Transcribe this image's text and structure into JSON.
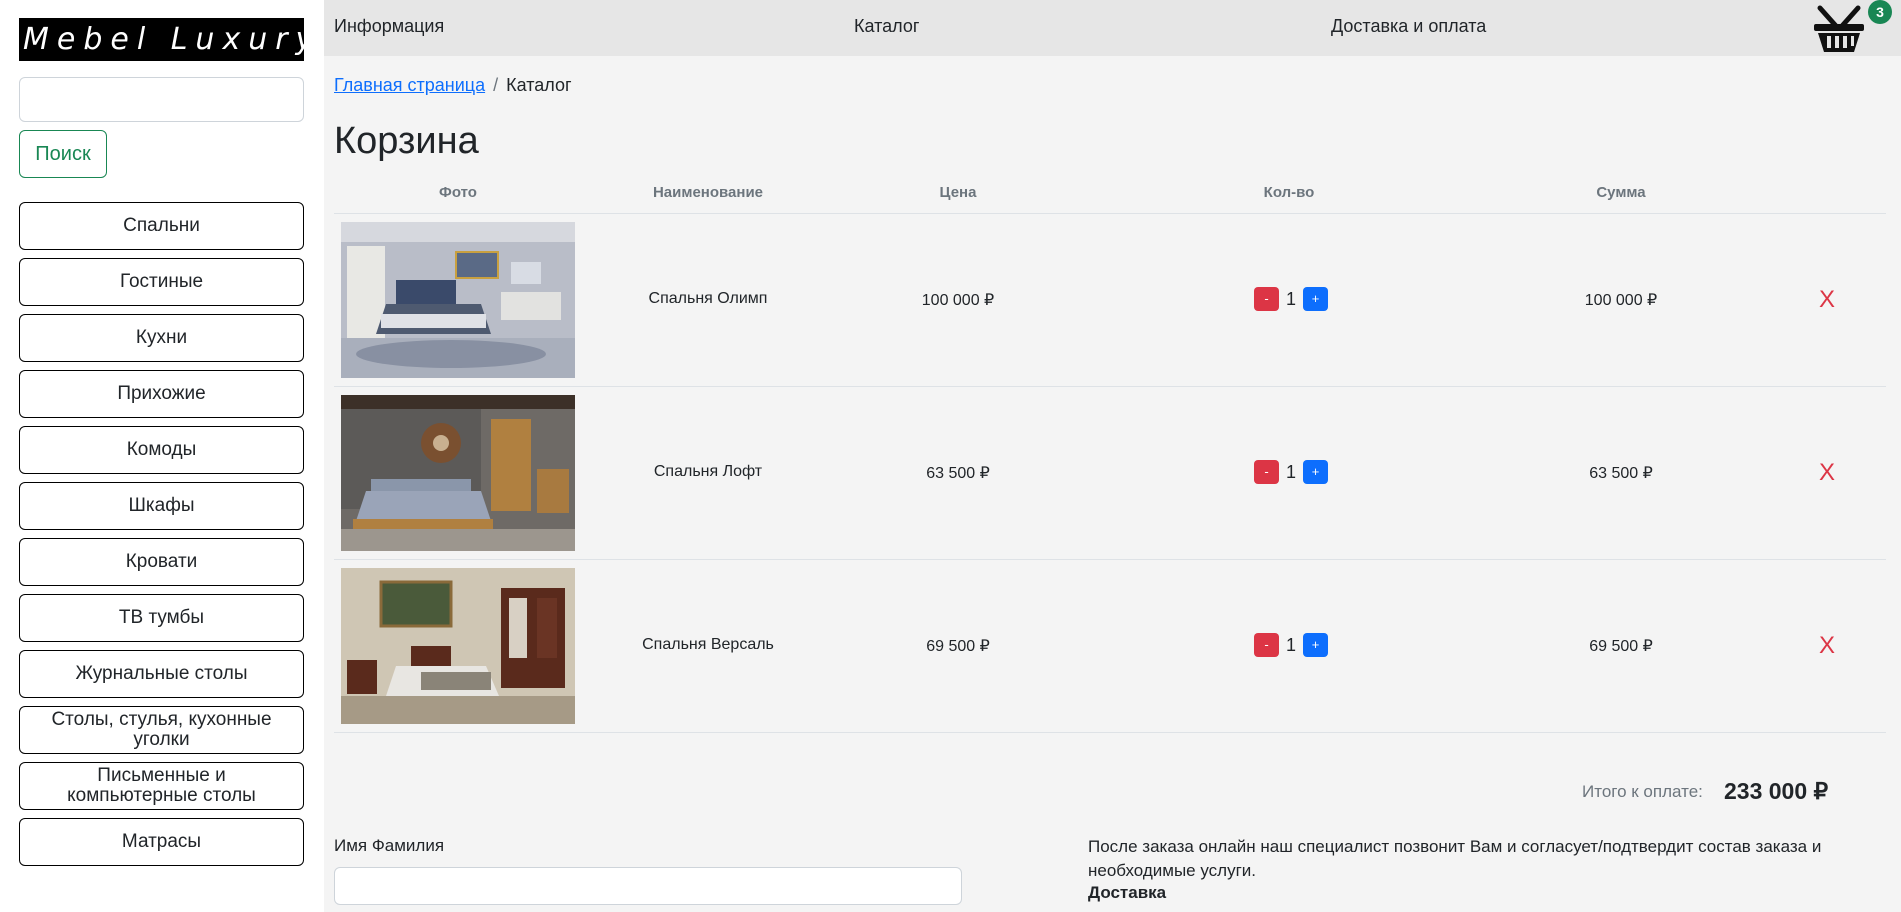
{
  "brand": {
    "logo_text": "Mebel Luxury"
  },
  "search": {
    "button_label": "Поиск",
    "placeholder": ""
  },
  "categories": [
    "Спальни",
    "Гостиные",
    "Кухни",
    "Прихожие",
    "Комоды",
    "Шкафы",
    "Кровати",
    "ТВ тумбы",
    "Журнальные столы",
    "Столы, стулья, кухонные уголки",
    "Письменные и компьютерные столы",
    "Матрасы"
  ],
  "nav": {
    "info": "Информация",
    "catalog": "Каталог",
    "delivery": "Доставка и оплата",
    "cart_count": "3"
  },
  "breadcrumb": {
    "home": "Главная страница",
    "separator": "/",
    "current": "Каталог"
  },
  "page_title": "Корзина",
  "table": {
    "headers": {
      "photo": "Фото",
      "name": "Наименование",
      "price": "Цена",
      "qty": "Кол-во",
      "sum": "Сумма"
    },
    "rows": [
      {
        "name": "Спальня Олимп",
        "price": "100 000 ₽",
        "qty": "1",
        "sum": "100 000 ₽",
        "minus": "-",
        "plus": "+",
        "delete": "X"
      },
      {
        "name": "Спальня Лофт",
        "price": "63 500 ₽",
        "qty": "1",
        "sum": "63 500 ₽",
        "minus": "-",
        "plus": "+",
        "delete": "X"
      },
      {
        "name": "Спальня Версаль",
        "price": "69 500 ₽",
        "qty": "1",
        "sum": "69 500 ₽",
        "minus": "-",
        "plus": "+",
        "delete": "X"
      }
    ]
  },
  "total": {
    "label": "Итого к оплате:",
    "value": "233 000 ₽"
  },
  "form": {
    "name_label": "Имя Фамилия"
  },
  "info": {
    "text": "После заказа онлайн наш специалист позвонит Вам и согласует/подтвердит состав заказа и необходимые услуги.",
    "delivery_heading": "Доставка"
  },
  "colors": {
    "danger": "#dc3545",
    "primary": "#0d6efd",
    "success": "#198754"
  }
}
